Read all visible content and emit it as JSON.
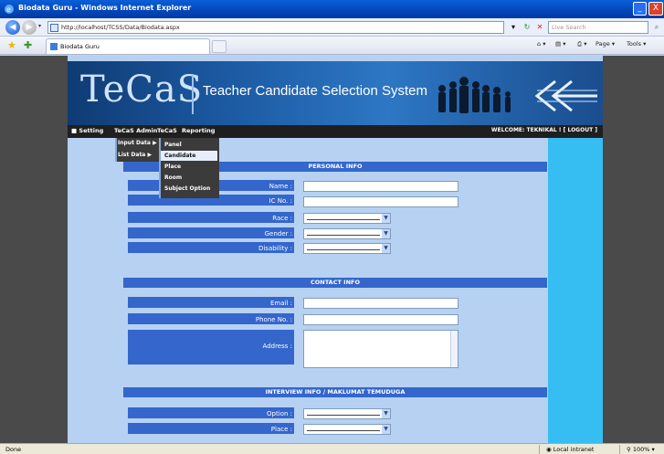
{
  "window": {
    "title": "Biodata Guru - Windows Internet Explorer",
    "minimize": "_",
    "close": "X"
  },
  "addressbar": {
    "url": "http://localhost/TCSS/Data/Biodata.aspx",
    "search_placeholder": "Live Search"
  },
  "tabs": [
    {
      "label": "Biodata Guru"
    }
  ],
  "commandbar": {
    "page_label": "Page",
    "tools_label": "Tools"
  },
  "banner": {
    "logo": "TeCaS",
    "subtitle": "Teacher Candidate Selection System"
  },
  "menu": {
    "items": [
      "Setting",
      "TeCaS Admin",
      "TeCaS",
      "Reporting"
    ],
    "welcome": "WELCOME: TEKNIKAL ! [ LOGOUT ]"
  },
  "dropdown_level1": [
    "Input Data",
    "List Data"
  ],
  "dropdown_level2": [
    "Panel",
    "Candidate",
    "Place",
    "Room",
    "Subject Option"
  ],
  "dropdown_level2_selected": "Candidate",
  "sections": {
    "personal": {
      "title": "PERSONAL INFO",
      "fields": [
        "Name :",
        "IC No. :",
        "Race :",
        "Gender :",
        "Disability :"
      ]
    },
    "contact": {
      "title": "CONTACT INFO",
      "fields": [
        "Email :",
        "Phone No. :",
        "Address :"
      ]
    },
    "interview": {
      "title": "INTERVIEW INFO / MAKLUMAT TEMUDUGA",
      "fields": [
        "Option :",
        "Place :"
      ]
    }
  },
  "status": {
    "text": "Done",
    "zone": "Local intranet",
    "zoom": "100%"
  }
}
